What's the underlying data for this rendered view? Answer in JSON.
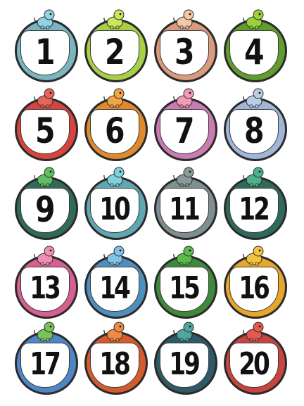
{
  "stickers": [
    {
      "number": "1",
      "ring_color": "#7bb5bf",
      "dino": "blue-dinosaur-icon",
      "dino_color": "#8fd3e4"
    },
    {
      "number": "2",
      "ring_color": "#a8cf45",
      "dino": "green-dinosaur-icon",
      "dino_color": "#c6e85a"
    },
    {
      "number": "3",
      "ring_color": "#d99a7d",
      "dino": "peach-dinosaur-icon",
      "dino_color": "#f3c7a8"
    },
    {
      "number": "4",
      "ring_color": "#5f9d2f",
      "dino": "lime-dinosaur-icon",
      "dino_color": "#9ad13c"
    },
    {
      "number": "5",
      "ring_color": "#d8443d",
      "dino": "red-dinosaur-icon",
      "dino_color": "#e5655a"
    },
    {
      "number": "6",
      "ring_color": "#e08a2c",
      "dino": "orange-dinosaur-icon",
      "dino_color": "#f2a446"
    },
    {
      "number": "7",
      "ring_color": "#c97bb4",
      "dino": "pink-bird-icon",
      "dino_color": "#f29bb6"
    },
    {
      "number": "8",
      "ring_color": "#9fb6d8",
      "dino": "pterodactyl-icon",
      "dino_color": "#b8cde6"
    },
    {
      "number": "9",
      "ring_color": "#2f6b58",
      "dino": "green-dinosaur-icon",
      "dino_color": "#5fbf63"
    },
    {
      "number": "10",
      "ring_color": "#5fa7b3",
      "dino": "teal-dinosaur-icon",
      "dino_color": "#7fd1dc"
    },
    {
      "number": "11",
      "ring_color": "#7f8e8f",
      "dino": "triceratops-icon",
      "dino_color": "#8a9a9c"
    },
    {
      "number": "12",
      "ring_color": "#2e6a5c",
      "dino": "triceratops-icon",
      "dino_color": "#4fb08a"
    },
    {
      "number": "13",
      "ring_color": "#d85f92",
      "dino": "pink-dinosaur-icon",
      "dino_color": "#ef8fb7"
    },
    {
      "number": "14",
      "ring_color": "#4f8fbf",
      "dino": "longneck-dinosaur-icon",
      "dino_color": "#7fc3e8"
    },
    {
      "number": "15",
      "ring_color": "#3f8a3a",
      "dino": "green-dinosaur-icon",
      "dino_color": "#59bb4c"
    },
    {
      "number": "16",
      "ring_color": "#e8a72c",
      "dino": "stegosaurus-icon",
      "dino_color": "#f4c23d"
    },
    {
      "number": "17",
      "ring_color": "#4f86c6",
      "dino": "dinosaur-egg-icon",
      "dino_color": "#7ac35a"
    },
    {
      "number": "18",
      "ring_color": "#d65a2c",
      "dino": "longneck-dinosaur-icon",
      "dino_color": "#f08a44"
    },
    {
      "number": "19",
      "ring_color": "#2d5a66",
      "dino": "ankylosaurus-icon",
      "dino_color": "#4fa7a0"
    },
    {
      "number": "20",
      "ring_color": "#c9433f",
      "dino": "red-dragon-icon",
      "dino_color": "#e55a4e"
    }
  ]
}
